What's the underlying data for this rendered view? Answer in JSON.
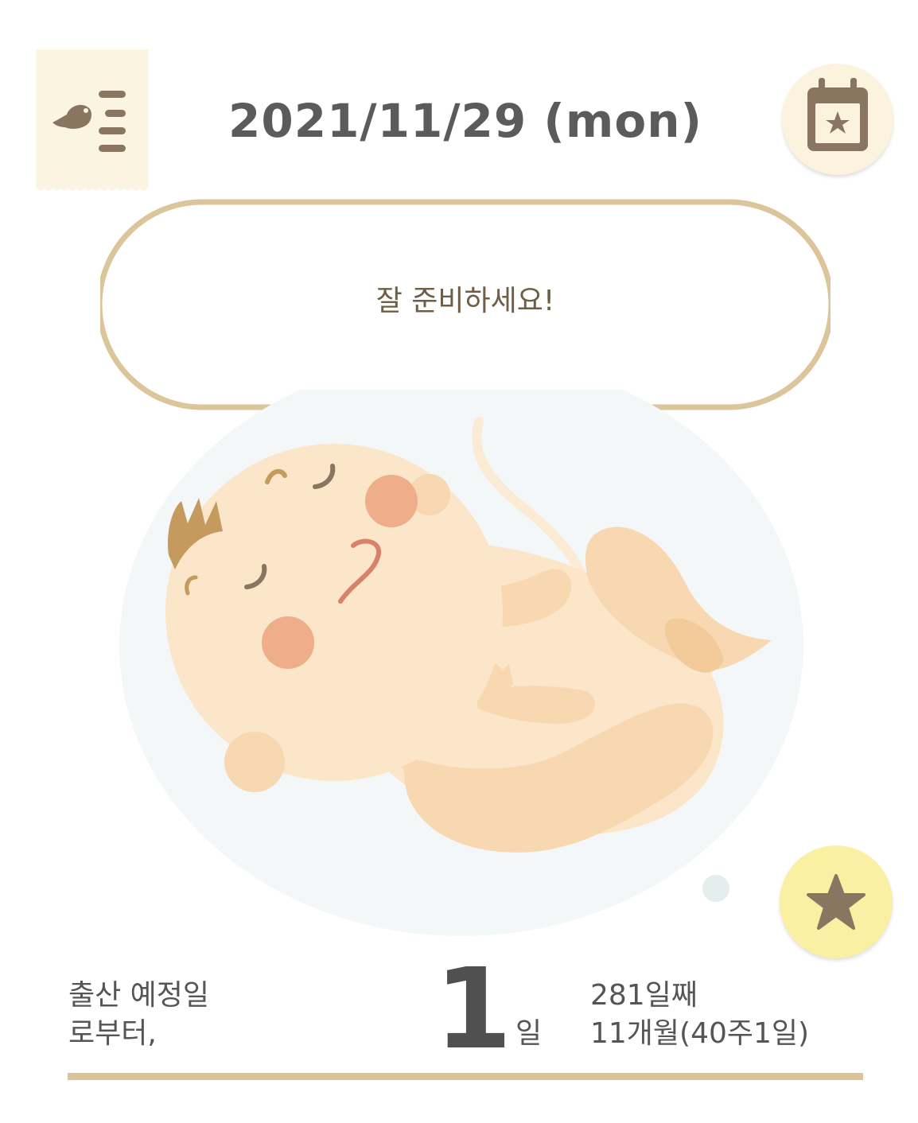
{
  "header": {
    "date_title": "2021/11/29 (mon)",
    "menu_icon": "menu-icon",
    "calendar_icon": "calendar-star-icon"
  },
  "bubble": {
    "message": "잘 준비하세요!"
  },
  "favorite": {
    "icon": "star-icon"
  },
  "countdown": {
    "label_line1": "출산 예정일",
    "label_line2": "로부터,",
    "number": "1",
    "unit": "일",
    "day_count": "281일째",
    "duration": "11개월(40주1일)"
  },
  "colors": {
    "accent_gold": "#dbc395",
    "menu_bg": "#faf4e1",
    "calendar_bg": "#fbf3de",
    "favorite_bg": "#faf0a4",
    "icon_brown": "#8a7660",
    "text_gray": "#555555"
  }
}
